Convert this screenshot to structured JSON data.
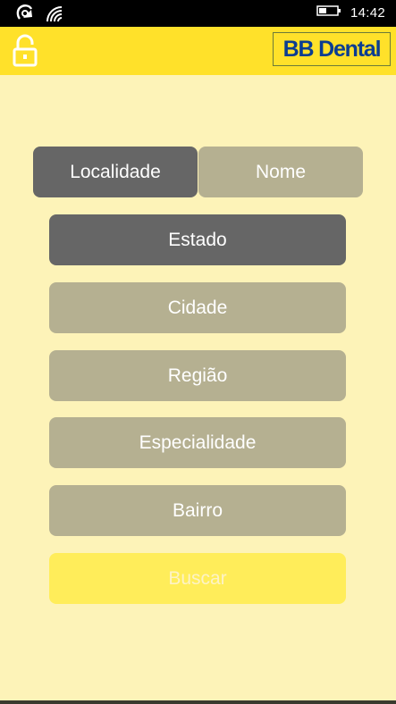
{
  "status_bar": {
    "time": "14:42",
    "icons": [
      "nfc-icon",
      "wifi-icon",
      "battery-icon"
    ]
  },
  "app_bar": {
    "logo_text": "BB Dental",
    "lock_icon": "unlock-icon",
    "background": "#ffe12a",
    "logo_color": "#0b3d91"
  },
  "tabs": [
    {
      "label": "Localidade",
      "active": true
    },
    {
      "label": "Nome",
      "active": false
    }
  ],
  "filters": {
    "estado": "Estado",
    "cidade": "Cidade",
    "regiao": "Região",
    "especialidade": "Especialidade",
    "bairro": "Bairro"
  },
  "search_button": {
    "label": "Buscar",
    "enabled": false
  },
  "colors": {
    "page_bg": "#fdf3b8",
    "selected": "#666666",
    "normal": "#b5b091",
    "disabled_accent": "#ffed5a"
  }
}
